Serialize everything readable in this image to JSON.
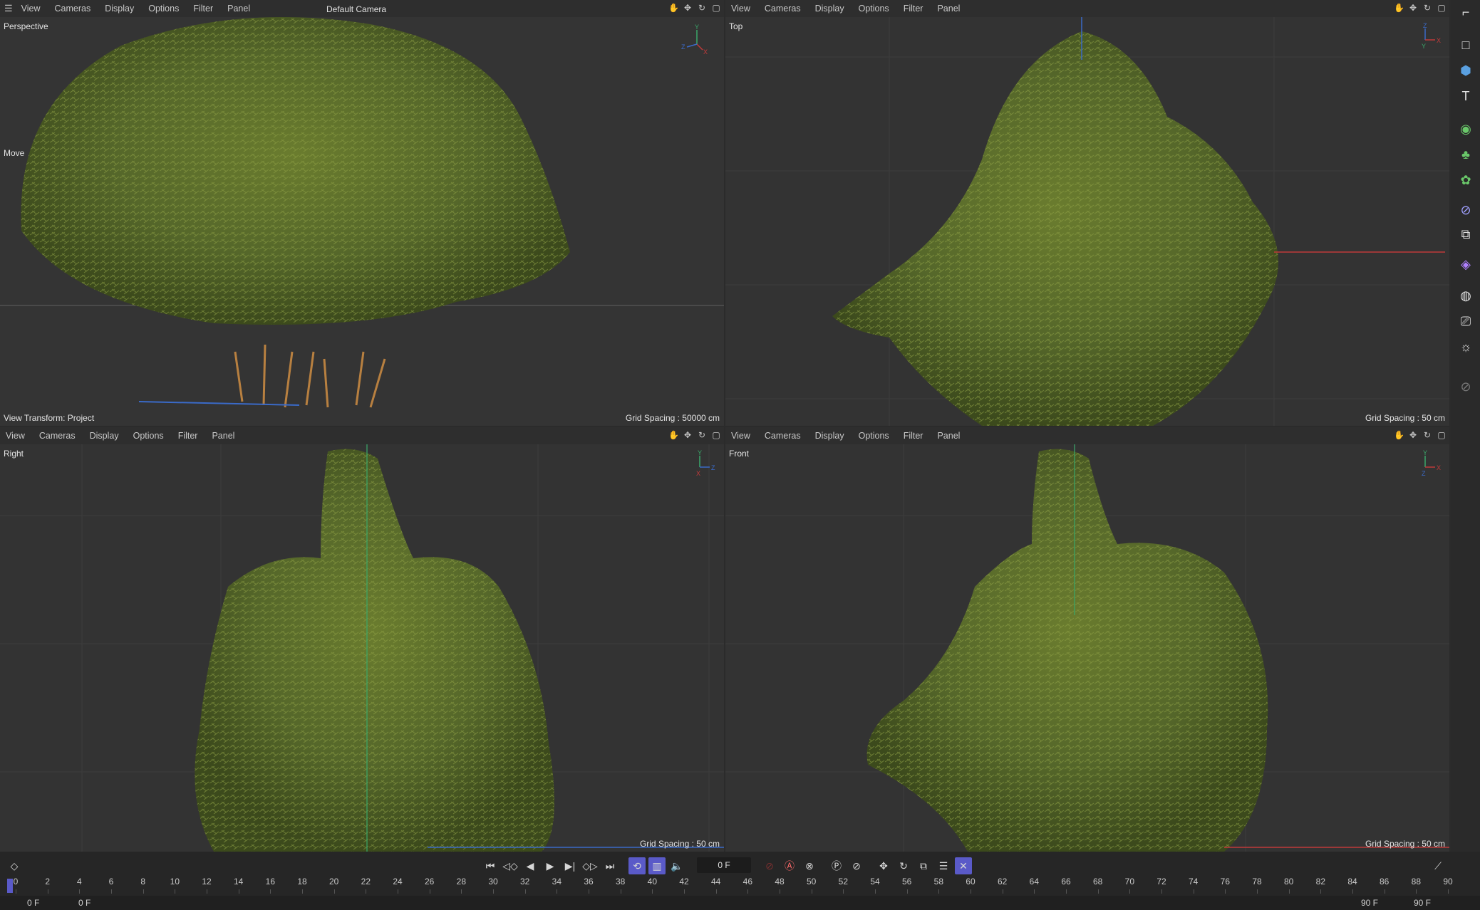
{
  "menu": [
    "View",
    "Cameras",
    "Display",
    "Options",
    "Filter",
    "Panel"
  ],
  "viewports": {
    "perspective": {
      "name": "Perspective",
      "camera": "Default Camera",
      "tool": "Move",
      "view_transform": "View Transform: Project",
      "grid_spacing": "Grid Spacing : 50000 cm",
      "gizmo": [
        "Y",
        "Z",
        "X"
      ]
    },
    "top": {
      "name": "Top",
      "grid_spacing": "Grid Spacing : 50 cm",
      "gizmo": [
        "Z",
        "Y",
        "X"
      ]
    },
    "right": {
      "name": "Right",
      "grid_spacing": "Grid Spacing : 50 cm",
      "gizmo": [
        "Y",
        "X",
        "Z"
      ]
    },
    "front": {
      "name": "Front",
      "grid_spacing": "Grid Spacing : 50 cm",
      "gizmo": [
        "Y",
        "Z",
        "X"
      ]
    }
  },
  "timeline": {
    "current_frame": "0 F",
    "start_field": "0 F",
    "start_field_2": "0 F",
    "end_field": "90 F",
    "end_field_2": "90 F",
    "ticks": [
      "0",
      "2",
      "4",
      "6",
      "8",
      "10",
      "12",
      "14",
      "16",
      "18",
      "20",
      "22",
      "24",
      "26",
      "28",
      "30",
      "32",
      "34",
      "36",
      "38",
      "40",
      "42",
      "44",
      "46",
      "48",
      "50",
      "52",
      "54",
      "56",
      "58",
      "60",
      "62",
      "64",
      "66",
      "68",
      "70",
      "72",
      "74",
      "76",
      "78",
      "80",
      "82",
      "84",
      "86",
      "88",
      "90"
    ]
  },
  "colors": {
    "foliage_dark": "#3a4a1a",
    "foliage_light": "#7d8f3a",
    "axis_red": "#c03a3a",
    "axis_green": "#3aa86a",
    "axis_blue": "#3a6ac8",
    "accent_blue": "#5a5ac8",
    "record_red": "#d03030"
  }
}
